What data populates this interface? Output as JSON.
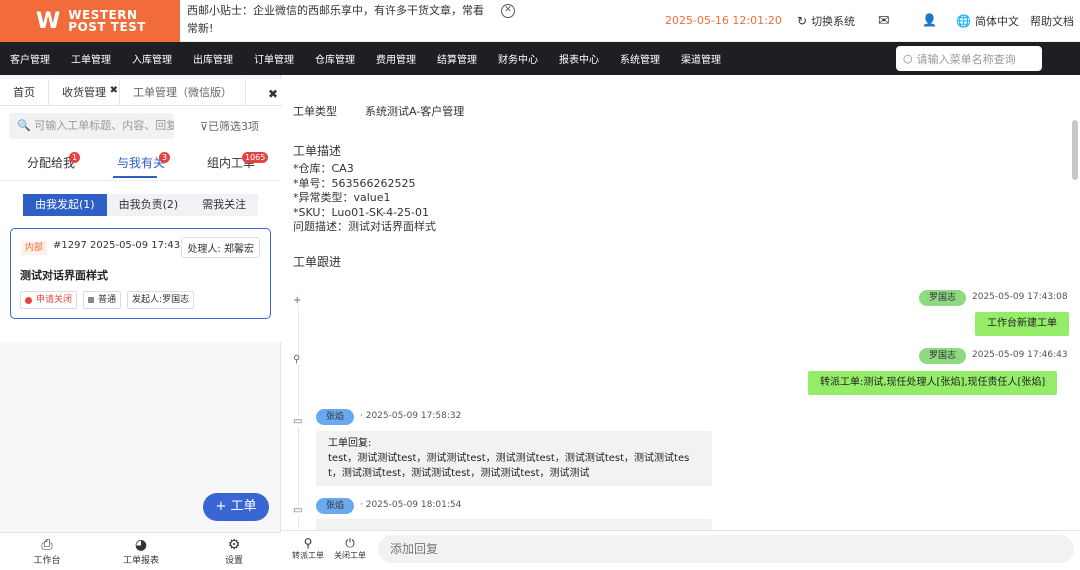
{
  "brand": {
    "logo_line1": "WESTERN",
    "logo_line2": "POST TEST"
  },
  "tip": {
    "text": "西邮小贴士：企业微信的西邮乐享中，有许多干货文章，常看常新!"
  },
  "topbar": {
    "datetime": "2025-05-16 12:01:20",
    "switch_system": "切换系统",
    "language": "简体中文",
    "help": "帮助文档"
  },
  "mainnav": [
    "客户管理",
    "工单管理",
    "入库管理",
    "出库管理",
    "订单管理",
    "仓库管理",
    "费用管理",
    "结算管理",
    "财务中心",
    "报表中心",
    "系统管理",
    "渠道管理"
  ],
  "menu_search": {
    "placeholder": "请输入菜单名称查询"
  },
  "tabs": [
    "首页",
    "收货管理",
    "工单管理（微信版）"
  ],
  "left": {
    "search_placeholder": "可输入工单标题、内容、回复",
    "filter": "已筛选3项",
    "subtabs": [
      {
        "label": "分配给我",
        "badge": "1"
      },
      {
        "label": "与我有关",
        "badge": "3"
      },
      {
        "label": "组内工单",
        "badge": "1065"
      }
    ],
    "segments": [
      "由我发起(1)",
      "由我负责(2)",
      "需我关注"
    ],
    "card": {
      "tag": "内部",
      "number": "#1297",
      "date": "2025-05-09 17:43",
      "handler": "处理人: 郑馨宏",
      "title": "测试对话界面样式",
      "chips": [
        "申请关闭",
        "普通",
        "发起人:罗国志"
      ]
    },
    "fab": "+ 工单",
    "bottomnav": [
      "工作台",
      "工单报表",
      "设置"
    ]
  },
  "right": {
    "type_label": "工单类型",
    "type_value": "系统测试A-客户管理",
    "desc_title": "工单描述",
    "desc_lines": [
      "*仓库：CA3",
      "*单号：563566262525",
      "*异常类型：value1",
      "*SKU：Luo01-SK-4-25-01",
      "问题描述：测试对话界面样式"
    ],
    "track_title": "工单跟进",
    "messages": [
      {
        "name": "罗国志",
        "time": "2025-05-09 17:43:08",
        "text": "工作台新建工单"
      },
      {
        "name": "罗国志",
        "time": "2025-05-09 17:46:43",
        "text": "转派工单:测试,现任处理人[张焰],现任责任人[张焰]"
      },
      {
        "name": "张焰",
        "time": "2025-05-09 17:58:32",
        "line1": "工单回复:",
        "line2": "test，测试测试test，测试测试test，测试测试test，测试测试test，测试测试tes",
        "line3": "t，测试测试test，测试测试test，测试测试test，测试测试"
      },
      {
        "name": "张焰",
        "time": "2025-05-09 18:01:54"
      }
    ],
    "reply_actions": [
      "转派工单",
      "关闭工单"
    ],
    "reply_placeholder": "添加回复"
  }
}
